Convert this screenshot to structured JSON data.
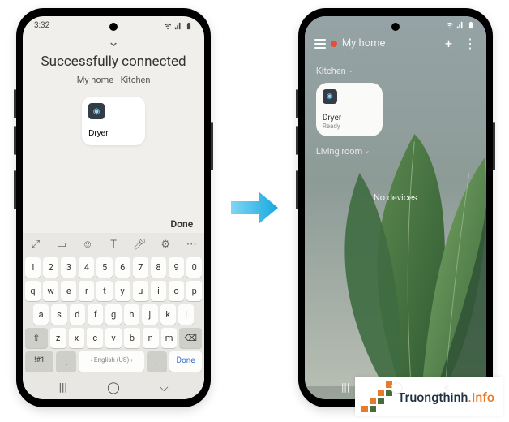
{
  "left": {
    "status_time": "3:32",
    "status_meridiem": "⬚",
    "title": "Successfully connected",
    "subtitle": "My home - Kitchen",
    "device_input_value": "Dryer",
    "done_label": "Done",
    "keyboard": {
      "toolbar_icons": [
        "expand-icon",
        "clipboard-icon",
        "emoji-icon",
        "text-icon",
        "mic-icon",
        "gear-icon",
        "more-icon"
      ],
      "row_num": [
        "1",
        "2",
        "3",
        "4",
        "5",
        "6",
        "7",
        "8",
        "9",
        "0"
      ],
      "row1": [
        "q",
        "w",
        "e",
        "r",
        "t",
        "y",
        "u",
        "i",
        "o",
        "p"
      ],
      "row2": [
        "a",
        "s",
        "d",
        "f",
        "g",
        "h",
        "j",
        "k",
        "l"
      ],
      "row3_shift": "⇧",
      "row3": [
        "z",
        "x",
        "c",
        "v",
        "b",
        "n",
        "m"
      ],
      "row3_back": "⌫",
      "row4_sym": "!#1",
      "row4_comma": ",",
      "row4_lang": "English (US)",
      "row4_period": ".",
      "row4_done": "Done"
    },
    "nav": {
      "recent": "|||",
      "home": "◯",
      "back": "⌵"
    }
  },
  "right": {
    "status_time": "",
    "header_title": "My home",
    "room1": "Kitchen",
    "device": {
      "name": "Dryer",
      "status": "Ready"
    },
    "room2": "Living room",
    "no_devices": "No devices",
    "nav": {
      "recent": "|||",
      "home": "◯",
      "back": "<"
    }
  },
  "watermark": {
    "text_main": "Truongthinh",
    "text_suffix": ".Info",
    "colors": {
      "orange": "#e77a2b",
      "green": "#4a6b3f"
    }
  }
}
